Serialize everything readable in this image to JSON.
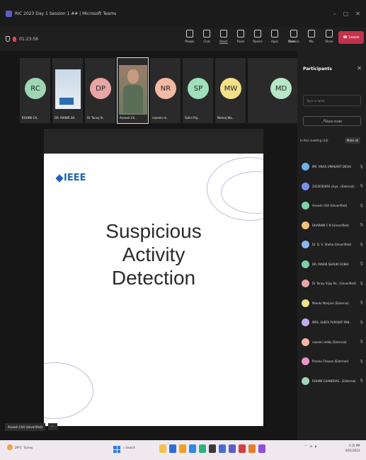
{
  "window": {
    "title": "RIC 2023 Day 1 Session 1 ## | Microsoft Teams"
  },
  "toolbar": {
    "timer": "01:23:56",
    "tools": [
      "People",
      "Chat",
      "React",
      "Raise",
      "Rooms",
      "Apps",
      "More",
      "Camera",
      "Mic",
      "Share"
    ],
    "leave_label": "Leave"
  },
  "participants_strip": [
    {
      "initials": "RC",
      "name": "ROHINI CH..",
      "color": "#9ed6b4"
    },
    {
      "initials": "",
      "name": "DR. MANIR DA..",
      "color": ""
    },
    {
      "initials": "DP",
      "name": "Dr Tonoy N..",
      "color": "#e8a5a5"
    },
    {
      "initials": "",
      "name": "Aneesh Ch..",
      "color": ""
    },
    {
      "initials": "NR",
      "name": "naveen re..",
      "color": "#f2b9a4"
    },
    {
      "initials": "SP",
      "name": "Salini Puj..",
      "color": "#9fe0ba"
    },
    {
      "initials": "MW",
      "name": "Neeraj Wa..",
      "color": "#f2e08a"
    },
    {
      "initials": "MD",
      "name": "",
      "color": "#b6e8c5"
    }
  ],
  "slide": {
    "brand": "IEEE",
    "title_lines": [
      "Suspicious",
      "Activity",
      "Detection"
    ]
  },
  "speaker_tag": "Aneesh Chit (Unverified)",
  "panel": {
    "title": "Participants",
    "search_placeholder": "Type a name",
    "share_label": "Share invite",
    "in_meeting": "In this meeting (14)",
    "mute_all": "Mute all",
    "list": [
      {
        "name": "MR. VIKAS UMAKANT DESAI",
        "color": "#6fb1e8"
      },
      {
        "name": "2023030093 chya.. (External)",
        "color": "#7e8ef0"
      },
      {
        "name": "Aneesh Chit (Unverified)",
        "color": "#7cd3a4"
      },
      {
        "name": "DHARANI C N (Unverified)",
        "color": "#f0c27a"
      },
      {
        "name": "Dr. D. S. Shaha (Unverified)",
        "color": "#89b7f0"
      },
      {
        "name": "DR. MAHIR SHAUKI SOBHI",
        "color": "#7cd3a4"
      },
      {
        "name": "Dr Tonoy Vijay Pa.. (Unverified)",
        "color": "#e8a5a5"
      },
      {
        "name": "Mandu Manjare (External)",
        "color": "#f2e08a"
      },
      {
        "name": "MRS. SHEFA PUROHIT PAN..",
        "color": "#c7a9f0"
      },
      {
        "name": "naveen reddy (External)",
        "color": "#f2b9a4"
      },
      {
        "name": "Pranav Chavan (External)",
        "color": "#e896c8"
      },
      {
        "name": "ROHINI CHANDRAS.. (External)",
        "color": "#9ed6b4"
      }
    ]
  },
  "taskbar": {
    "weather_temp": "29°C",
    "weather_desc": "Sunny",
    "search_label": "Search",
    "time": "3:35 PM",
    "date": "6/01/2023"
  }
}
